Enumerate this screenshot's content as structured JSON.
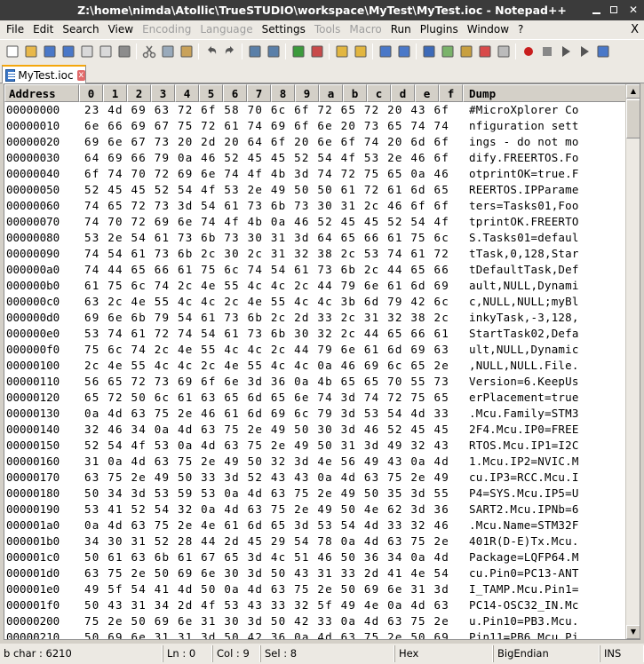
{
  "window": {
    "title": "Z:\\home\\nimda\\Atollic\\TrueSTUDIO\\workspace\\MyTest\\MyTest.ioc - Notepad++",
    "minimize_symbol": "",
    "maximize_symbol": "",
    "close_symbol": "✕"
  },
  "menu": {
    "items": [
      {
        "label": "File",
        "enabled": true
      },
      {
        "label": "Edit",
        "enabled": true
      },
      {
        "label": "Search",
        "enabled": true
      },
      {
        "label": "View",
        "enabled": true
      },
      {
        "label": "Encoding",
        "enabled": false
      },
      {
        "label": "Language",
        "enabled": false
      },
      {
        "label": "Settings",
        "enabled": true
      },
      {
        "label": "Tools",
        "enabled": false
      },
      {
        "label": "Macro",
        "enabled": false
      },
      {
        "label": "Run",
        "enabled": true
      },
      {
        "label": "Plugins",
        "enabled": true
      },
      {
        "label": "Window",
        "enabled": true
      },
      {
        "label": "?",
        "enabled": true
      }
    ],
    "close_label": "X"
  },
  "toolbar": {
    "icons": [
      "new-file-icon",
      "open-file-icon",
      "save-icon",
      "save-all-icon",
      "close-file-icon",
      "close-all-icon",
      "print-icon",
      "sep",
      "cut-icon",
      "copy-icon",
      "paste-icon",
      "sep",
      "undo-icon",
      "redo-icon",
      "sep",
      "find-icon",
      "replace-icon",
      "sep",
      "zoom-in-icon",
      "zoom-out-icon",
      "sep",
      "sync-vertical-icon",
      "sync-horizontal-icon",
      "sep",
      "word-wrap-icon",
      "show-all-chars-icon",
      "sep",
      "indent-guide-icon",
      "doc-map-icon",
      "function-list-icon",
      "folder-as-workspace-icon",
      "monitoring-icon",
      "sep",
      "record-macro-icon",
      "stop-record-icon",
      "play-macro-icon",
      "play-multiple-icon",
      "save-macro-icon"
    ]
  },
  "tab": {
    "label": "MyTest.ioc",
    "close_label": "x"
  },
  "hex_view": {
    "address_header": "Address",
    "column_headers": [
      "0",
      "1",
      "2",
      "3",
      "4",
      "5",
      "6",
      "7",
      "8",
      "9",
      "a",
      "b",
      "c",
      "d",
      "e",
      "f"
    ],
    "dump_header": "Dump",
    "rows": [
      {
        "addr": "00000000",
        "bytes": "23 4d 69 63 72 6f 58 70 6c 6f 72 65 72 20 43 6f",
        "dump": "#MicroXplorer Co"
      },
      {
        "addr": "00000010",
        "bytes": "6e 66 69 67 75 72 61 74 69 6f 6e 20 73 65 74 74",
        "dump": "nfiguration sett"
      },
      {
        "addr": "00000020",
        "bytes": "69 6e 67 73 20 2d 20 64 6f 20 6e 6f 74 20 6d 6f",
        "dump": "ings - do not mo"
      },
      {
        "addr": "00000030",
        "bytes": "64 69 66 79 0a 46 52 45 45 52 54 4f 53 2e 46 6f",
        "dump": "dify.FREERTOS.Fo"
      },
      {
        "addr": "00000040",
        "bytes": "6f 74 70 72 69 6e 74 4f 4b 3d 74 72 75 65 0a 46",
        "dump": "otprintOK=true.F"
      },
      {
        "addr": "00000050",
        "bytes": "52 45 45 52 54 4f 53 2e 49 50 50 61 72 61 6d 65",
        "dump": "REERTOS.IPParame"
      },
      {
        "addr": "00000060",
        "bytes": "74 65 72 73 3d 54 61 73 6b 73 30 31 2c 46 6f 6f",
        "dump": "ters=Tasks01,Foo"
      },
      {
        "addr": "00000070",
        "bytes": "74 70 72 69 6e 74 4f 4b 0a 46 52 45 45 52 54 4f",
        "dump": "tprintOK.FREERTO"
      },
      {
        "addr": "00000080",
        "bytes": "53 2e 54 61 73 6b 73 30 31 3d 64 65 66 61 75 6c",
        "dump": "S.Tasks01=defaul"
      },
      {
        "addr": "00000090",
        "bytes": "74 54 61 73 6b 2c 30 2c 31 32 38 2c 53 74 61 72",
        "dump": "tTask,0,128,Star"
      },
      {
        "addr": "000000a0",
        "bytes": "74 44 65 66 61 75 6c 74 54 61 73 6b 2c 44 65 66",
        "dump": "tDefaultTask,Def"
      },
      {
        "addr": "000000b0",
        "bytes": "61 75 6c 74 2c 4e 55 4c 4c 2c 44 79 6e 61 6d 69",
        "dump": "ault,NULL,Dynami"
      },
      {
        "addr": "000000c0",
        "bytes": "63 2c 4e 55 4c 4c 2c 4e 55 4c 4c 3b 6d 79 42 6c",
        "dump": "c,NULL,NULL;myBl"
      },
      {
        "addr": "000000d0",
        "bytes": "69 6e 6b 79 54 61 73 6b 2c 2d 33 2c 31 32 38 2c",
        "dump": "inkyTask,-3,128,"
      },
      {
        "addr": "000000e0",
        "bytes": "53 74 61 72 74 54 61 73 6b 30 32 2c 44 65 66 61",
        "dump": "StartTask02,Defa"
      },
      {
        "addr": "000000f0",
        "bytes": "75 6c 74 2c 4e 55 4c 4c 2c 44 79 6e 61 6d 69 63",
        "dump": "ult,NULL,Dynamic"
      },
      {
        "addr": "00000100",
        "bytes": "2c 4e 55 4c 4c 2c 4e 55 4c 4c 0a 46 69 6c 65 2e",
        "dump": ",NULL,NULL.File."
      },
      {
        "addr": "00000110",
        "bytes": "56 65 72 73 69 6f 6e 3d 36 0a 4b 65 65 70 55 73",
        "dump": "Version=6.KeepUs"
      },
      {
        "addr": "00000120",
        "bytes": "65 72 50 6c 61 63 65 6d 65 6e 74 3d 74 72 75 65",
        "dump": "erPlacement=true"
      },
      {
        "addr": "00000130",
        "bytes": "0a 4d 63 75 2e 46 61 6d 69 6c 79 3d 53 54 4d 33",
        "dump": ".Mcu.Family=STM3"
      },
      {
        "addr": "00000140",
        "bytes": "32 46 34 0a 4d 63 75 2e 49 50 30 3d 46 52 45 45",
        "dump": "2F4.Mcu.IP0=FREE"
      },
      {
        "addr": "00000150",
        "bytes": "52 54 4f 53 0a 4d 63 75 2e 49 50 31 3d 49 32 43",
        "dump": "RTOS.Mcu.IP1=I2C"
      },
      {
        "addr": "00000160",
        "bytes": "31 0a 4d 63 75 2e 49 50 32 3d 4e 56 49 43 0a 4d",
        "dump": "1.Mcu.IP2=NVIC.M"
      },
      {
        "addr": "00000170",
        "bytes": "63 75 2e 49 50 33 3d 52 43 43 0a 4d 63 75 2e 49",
        "dump": "cu.IP3=RCC.Mcu.I"
      },
      {
        "addr": "00000180",
        "bytes": "50 34 3d 53 59 53 0a 4d 63 75 2e 49 50 35 3d 55",
        "dump": "P4=SYS.Mcu.IP5=U"
      },
      {
        "addr": "00000190",
        "bytes": "53 41 52 54 32 0a 4d 63 75 2e 49 50 4e 62 3d 36",
        "dump": "SART2.Mcu.IPNb=6"
      },
      {
        "addr": "000001a0",
        "bytes": "0a 4d 63 75 2e 4e 61 6d 65 3d 53 54 4d 33 32 46",
        "dump": ".Mcu.Name=STM32F"
      },
      {
        "addr": "000001b0",
        "bytes": "34 30 31 52 28 44 2d 45 29 54 78 0a 4d 63 75 2e",
        "dump": "401R(D-E)Tx.Mcu."
      },
      {
        "addr": "000001c0",
        "bytes": "50 61 63 6b 61 67 65 3d 4c 51 46 50 36 34 0a 4d",
        "dump": "Package=LQFP64.M"
      },
      {
        "addr": "000001d0",
        "bytes": "63 75 2e 50 69 6e 30 3d 50 43 31 33 2d 41 4e 54",
        "dump": "cu.Pin0=PC13-ANT"
      },
      {
        "addr": "000001e0",
        "bytes": "49 5f 54 41 4d 50 0a 4d 63 75 2e 50 69 6e 31 3d",
        "dump": "I_TAMP.Mcu.Pin1="
      },
      {
        "addr": "000001f0",
        "bytes": "50 43 31 34 2d 4f 53 43 33 32 5f 49 4e 0a 4d 63",
        "dump": "PC14-OSC32_IN.Mc"
      },
      {
        "addr": "00000200",
        "bytes": "75 2e 50 69 6e 31 30 3d 50 42 33 0a 4d 63 75 2e",
        "dump": "u.Pin10=PB3.Mcu."
      },
      {
        "addr": "00000210",
        "bytes": "50 69 6e 31 31 3d 50 42 36 0a 4d 63 75 2e 50 69",
        "dump": "Pin11=PB6.Mcu.Pi"
      }
    ]
  },
  "status": {
    "nb_char": "b char : 6210",
    "ln": "Ln : 0",
    "col": "Col : 9",
    "sel": "Sel : 8",
    "view_mode": "Hex",
    "endian": "BigEndian",
    "ins": "INS"
  }
}
